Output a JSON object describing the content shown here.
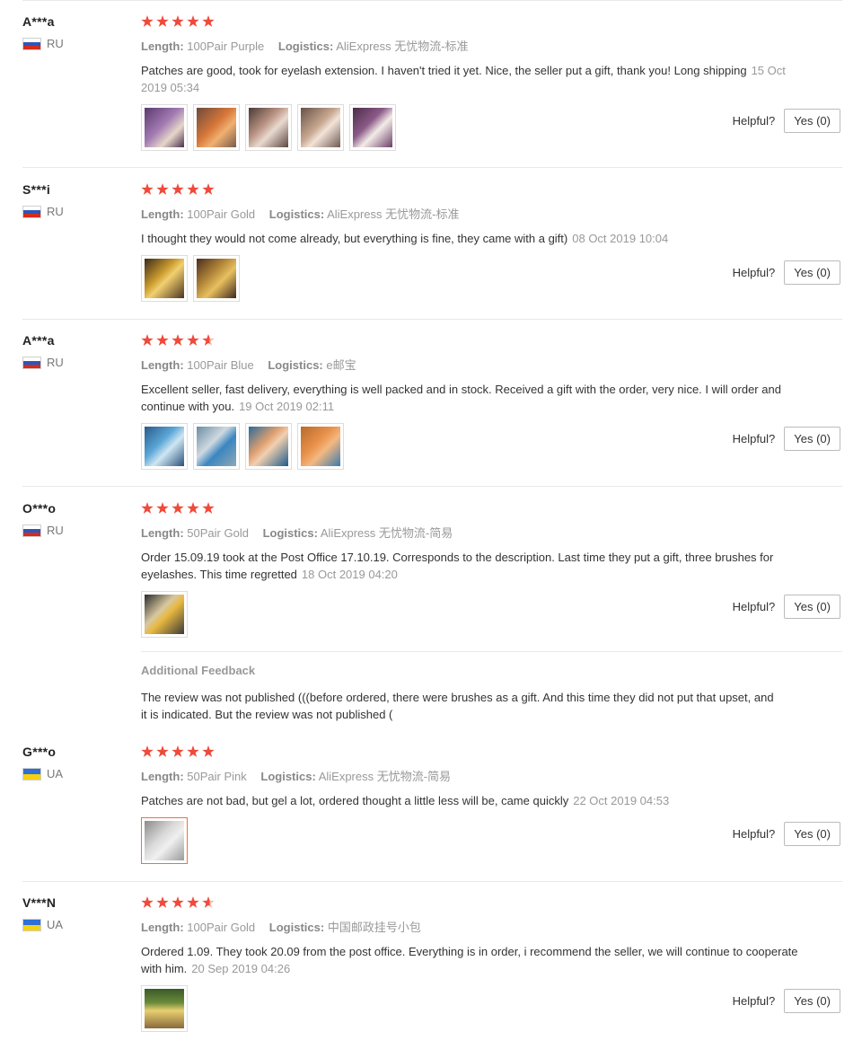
{
  "labels": {
    "length": "Length:",
    "logistics": "Logistics:",
    "helpful": "Helpful?",
    "yes": "Yes (0)",
    "additional_feedback": "Additional Feedback"
  },
  "colors": {
    "star": "#f04a3a",
    "date": "#999999",
    "separator": "#e8e8e8",
    "active_thumb_border": "#f07236"
  },
  "reviews": [
    {
      "user": "A***a",
      "country": "RU",
      "flag": "russia-flag-icon",
      "stars": 5,
      "length": "100Pair Purple",
      "logistics": "AliExpress 无忧物流-标准",
      "text": "Patches are good, took for eyelash extension. I haven't tried it yet. Nice, the seller put a gift, thank you! Long shipping",
      "date": "15 Oct 2019 05:34",
      "photo_count": 5,
      "helpful_count": "Yes (0)"
    },
    {
      "user": "S***i",
      "country": "RU",
      "flag": "russia-flag-icon",
      "stars": 5,
      "length": "100Pair Gold",
      "logistics": "AliExpress 无忧物流-标准",
      "text": "I thought they would not come already, but everything is fine, they came with a gift)",
      "date": "08 Oct 2019 10:04",
      "photo_count": 2,
      "helpful_count": "Yes (0)"
    },
    {
      "user": "A***a",
      "country": "RU",
      "flag": "russia-flag-icon",
      "stars": 4.5,
      "length": "100Pair Blue",
      "logistics": "e邮宝",
      "text": "Excellent seller, fast delivery, everything is well packed and in stock. Received a gift with the order, very nice. I will order and continue with you.",
      "date": "19 Oct 2019 02:11",
      "photo_count": 4,
      "helpful_count": "Yes (0)"
    },
    {
      "user": "O***o",
      "country": "RU",
      "flag": "russia-flag-icon",
      "stars": 5,
      "length": "50Pair Gold",
      "logistics": "AliExpress 无忧物流-简易",
      "text": "Order 15.09.19 took at the Post Office 17.10.19. Corresponds to the description. Last time they put a gift, three brushes for eyelashes. This time regretted",
      "date": "18 Oct 2019 04:20",
      "photo_count": 1,
      "helpful_count": "Yes (0)",
      "additional": "The review was not published (((before ordered, there were brushes as a gift. And this time they did not put that upset, and it is indicated. But the review was not published ("
    },
    {
      "user": "G***o",
      "country": "UA",
      "flag": "ukraine-flag-icon",
      "stars": 5,
      "length": "50Pair Pink",
      "logistics": "AliExpress 无忧物流-简易",
      "text": "Patches are not bad, but gel a lot, ordered thought a little less will be, came quickly",
      "date": "22 Oct 2019 04:53",
      "photo_count": 1,
      "helpful_count": "Yes (0)"
    },
    {
      "user": "V***N",
      "country": "UA",
      "flag": "ukraine-flag-icon",
      "stars": 4.5,
      "length": "100Pair Gold",
      "logistics": "中国邮政挂号小包",
      "text": "Ordered 1.09. They took 20.09 from the post office. Everything is in order, i recommend the seller, we will continue to cooperate with him.",
      "date": "20 Sep 2019 04:26",
      "photo_count": 1,
      "helpful_count": "Yes (0)"
    }
  ]
}
